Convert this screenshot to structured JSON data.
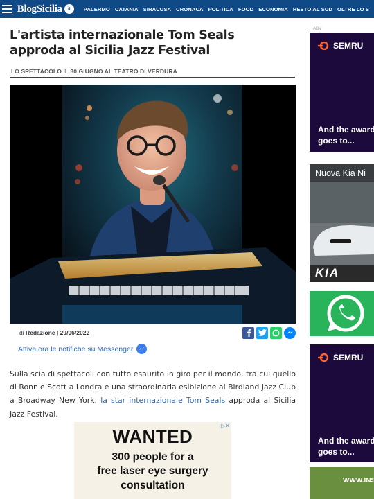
{
  "header": {
    "logo_text": "BlogSicilia",
    "logo_badge": "it",
    "nav_items": [
      "PALERMO",
      "CATANIA",
      "SIRACUSA",
      "CRONACA",
      "POLITICA",
      "FOOD",
      "ECONOMIA",
      "RESTO AL SUD",
      "OLTRE LO S"
    ]
  },
  "article": {
    "title": "L'artista internazionale Tom Seals approda al Sicilia Jazz Festival",
    "subtitle": "LO SPETTACOLO IL 30 GIUGNO AL TEATRO DI VERDURA",
    "byline_prefix": "di",
    "author": "Redazione",
    "date": "29/06/2022",
    "notify_text": "Attiva ora le notifiche su Messenger",
    "body_before_link": "Sulla scia di spettacoli con tutto esaurito in giro per il mondo, tra cui quello di Ronnie Scott a Londra e una straordinaria esibizione al Birdland Jazz Club a Broadway New York, ",
    "body_link": "la star internazionale Tom Seals",
    "body_after_link": " approda al Sicilia Jazz Festival."
  },
  "share_icons": [
    "facebook-icon",
    "twitter-icon",
    "whatsapp-icon",
    "messenger-icon"
  ],
  "inline_ad": {
    "line1": "WANTED",
    "line2": "300 people for a",
    "line3": "free laser eye surgery",
    "line4": "consultation"
  },
  "sidebar": {
    "ad_label": "ADV",
    "semrush_logo": "SEMRU",
    "semrush_text1": "And the award",
    "semrush_text2": "goes to...",
    "kia_title": "Nuova Kia Ni",
    "kia_brand": "KIA",
    "semrush2_logo": "SEMRU",
    "semrush2_text1": "And the award",
    "semrush2_text2": "goes to...",
    "ins_text": "WWW.INS"
  },
  "colors": {
    "brand_blue": "#0f4a86",
    "link_blue": "#2f67b3",
    "semrush_bg": "#1c0a3d",
    "semrush_orange": "#ff642d"
  }
}
